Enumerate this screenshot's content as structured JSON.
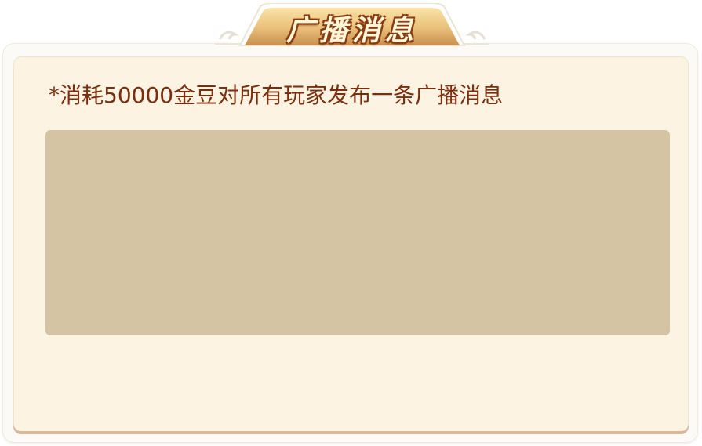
{
  "dialog": {
    "title": "广播消息",
    "instruction": "*消耗50000金豆对所有玩家发布一条广播消息",
    "message_input": {
      "value": "",
      "placeholder": ""
    }
  },
  "colors": {
    "panel_bg": "#fdf3e2",
    "input_bg": "#d5c4a3",
    "instruction_text": "#7a2e0e",
    "title_gold": "#e9c27a"
  }
}
